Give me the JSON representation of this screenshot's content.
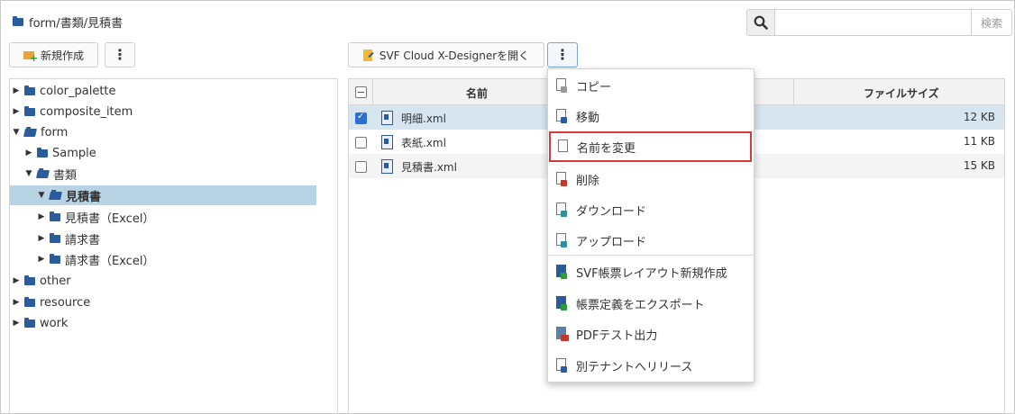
{
  "breadcrumb": {
    "path": "form/書類/見積書"
  },
  "search": {
    "placeholder": "",
    "button_label": "検索"
  },
  "toolbar": {
    "new_button": "新規作成",
    "open_designer_button": "SVF Cloud X-Designerを開く"
  },
  "tree": [
    {
      "label": "color_palette",
      "arrow": "▶",
      "level": 0,
      "open": false,
      "selected": false
    },
    {
      "label": "composite_item",
      "arrow": "▶",
      "level": 0,
      "open": false,
      "selected": false
    },
    {
      "label": "form",
      "arrow": "▼",
      "level": 0,
      "open": true,
      "selected": false
    },
    {
      "label": "Sample",
      "arrow": "▶",
      "level": 1,
      "open": false,
      "selected": false
    },
    {
      "label": "書類",
      "arrow": "▼",
      "level": 1,
      "open": true,
      "selected": false
    },
    {
      "label": "見積書",
      "arrow": "▼",
      "level": 2,
      "open": true,
      "selected": true
    },
    {
      "label": "見積書（Excel）",
      "arrow": "▶",
      "level": 2,
      "open": false,
      "selected": false
    },
    {
      "label": "請求書",
      "arrow": "▶",
      "level": 2,
      "open": false,
      "selected": false
    },
    {
      "label": "請求書（Excel）",
      "arrow": "▶",
      "level": 2,
      "open": false,
      "selected": false
    },
    {
      "label": "other",
      "arrow": "▶",
      "level": 0,
      "open": false,
      "selected": false
    },
    {
      "label": "resource",
      "arrow": "▶",
      "level": 0,
      "open": false,
      "selected": false
    },
    {
      "label": "work",
      "arrow": "▶",
      "level": 0,
      "open": false,
      "selected": false
    }
  ],
  "table": {
    "columns": {
      "name": "名前",
      "size": "ファイルサイズ"
    },
    "rows": [
      {
        "name": "明細.xml",
        "size": "12 KB",
        "checked": true
      },
      {
        "name": "表紙.xml",
        "size": "11 KB",
        "checked": false
      },
      {
        "name": "見積書.xml",
        "size": "15 KB",
        "checked": false
      }
    ]
  },
  "context_menu": [
    {
      "label": "コピー",
      "icon": "copy-icon"
    },
    {
      "label": "移動",
      "icon": "move-icon"
    },
    {
      "label": "名前を変更",
      "icon": "rename-icon",
      "highlighted": true
    },
    {
      "label": "削除",
      "icon": "delete-icon"
    },
    {
      "label": "ダウンロード",
      "icon": "download-icon"
    },
    {
      "label": "アップロード",
      "icon": "upload-icon"
    },
    {
      "label": "SVF帳票レイアウト新規作成",
      "icon": "new-layout-icon"
    },
    {
      "label": "帳票定義をエクスポート",
      "icon": "export-icon"
    },
    {
      "label": "PDFテスト出力",
      "icon": "pdf-print-icon"
    },
    {
      "label": "別テナントへリリース",
      "icon": "release-icon"
    }
  ],
  "colors": {
    "selected_row": "#b8d4e4",
    "highlight_border": "#d43b3b",
    "folder": "#2a5b9c",
    "checkbox_checked": "#2c6fcf"
  }
}
